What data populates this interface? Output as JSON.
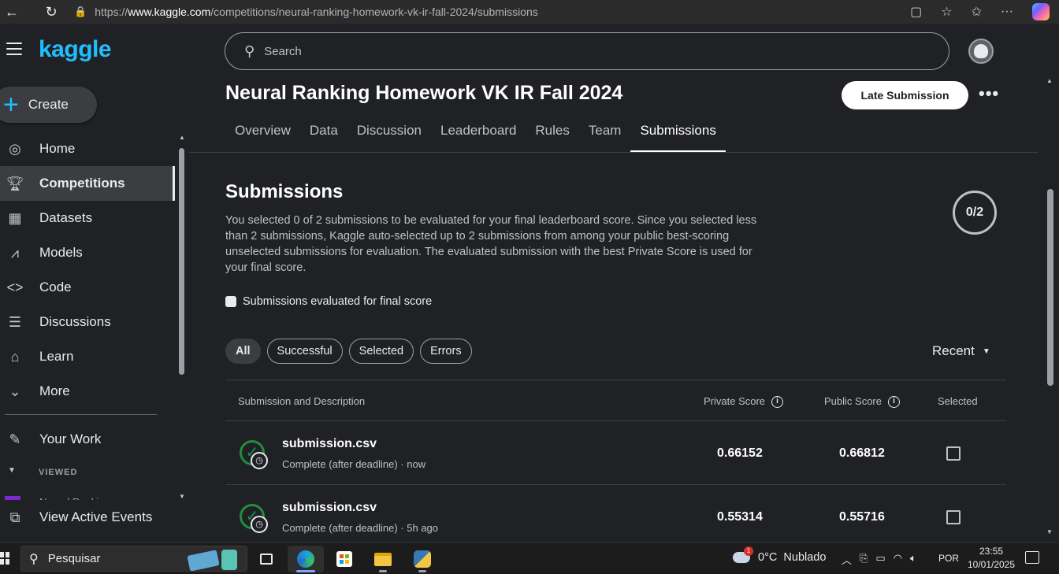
{
  "browser": {
    "url_prefix": "https://",
    "url_host": "www.kaggle.com",
    "url_path": "/competitions/neural-ranking-homework-vk-ir-fall-2024/submissions"
  },
  "sidebar": {
    "logo": "kaggle",
    "create_label": "Create",
    "items": [
      {
        "label": "Home",
        "icon": "compass-icon"
      },
      {
        "label": "Competitions",
        "icon": "trophy-icon"
      },
      {
        "label": "Datasets",
        "icon": "table-icon"
      },
      {
        "label": "Models",
        "icon": "models-icon"
      },
      {
        "label": "Code",
        "icon": "code-icon"
      },
      {
        "label": "Discussions",
        "icon": "comments-icon"
      },
      {
        "label": "Learn",
        "icon": "school-icon"
      },
      {
        "label": "More",
        "icon": "chevron-down-icon"
      }
    ],
    "your_work": "Your Work",
    "viewed_heading": "VIEWED",
    "viewed_item": "Neural Ranking Homew...",
    "active_events": "View Active Events"
  },
  "search": {
    "placeholder": "Search"
  },
  "competition": {
    "title": "Neural Ranking Homework VK IR Fall 2024",
    "late_submission": "Late Submission",
    "tabs": [
      "Overview",
      "Data",
      "Discussion",
      "Leaderboard",
      "Rules",
      "Team",
      "Submissions"
    ],
    "active_tab": "Submissions"
  },
  "submissions": {
    "title": "Submissions",
    "description": "You selected 0 of 2 submissions to be evaluated for your final leaderboard score. Since you selected less than 2 submissions, Kaggle auto-selected up to 2 submissions from among your public best-scoring unselected submissions for evaluation. The evaluated submission with the best Private Score is used for your final score.",
    "counter": "0/2",
    "checkbox_label": "Submissions evaluated for final score",
    "filters": [
      "All",
      "Successful",
      "Selected",
      "Errors"
    ],
    "active_filter": "All",
    "sort": "Recent",
    "columns": {
      "submission": "Submission and Description",
      "private": "Private Score",
      "public": "Public Score",
      "selected": "Selected"
    },
    "rows": [
      {
        "file": "submission.csv",
        "meta": "Complete (after deadline) · now",
        "private": "0.66152",
        "public": "0.66812"
      },
      {
        "file": "submission.csv",
        "meta": "Complete (after deadline) · 5h ago",
        "private": "0.55314",
        "public": "0.55716"
      }
    ]
  },
  "taskbar": {
    "search_label": "Pesquisar",
    "weather_temp": "0°C",
    "weather_desc": "Nublado",
    "weather_badge": "1",
    "lang": "POR",
    "time": "23:55",
    "date": "10/01/2025"
  }
}
